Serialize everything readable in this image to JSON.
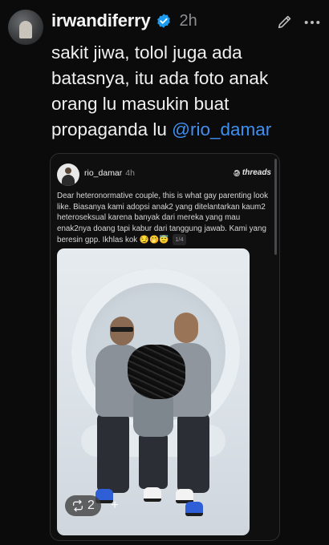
{
  "post": {
    "username": "irwandiferry",
    "time": "2h",
    "text_main": "sakit jiwa, tolol juga ada batasnya, itu ada foto anak orang lu masukin buat propaganda lu ",
    "mention": "@rio_damar"
  },
  "quote": {
    "username": "rio_damar",
    "time": "4h",
    "source": "threads",
    "text": "Dear heteronormative couple, this is what gay parenting look like. Biasanya kami adopsi anak2 yang ditelantarkan kaum2 heteroseksual karena banyak dari mereka yang mau enak2nya doang tapi kabur dari tanggung jawab. Kami yang beresin gpp. Ikhlas kok 😏🤭😇",
    "counter": "1/4",
    "repost_count": "2",
    "plus": "+"
  },
  "colors": {
    "background": "#0b0b0c",
    "verified": "#1d9bf0",
    "mention": "#3f8ff0",
    "muted": "#8e8e93"
  },
  "icons": [
    "verified-icon",
    "edit-icon",
    "more-icon",
    "threads-logo-icon",
    "repost-icon",
    "plus-icon"
  ]
}
